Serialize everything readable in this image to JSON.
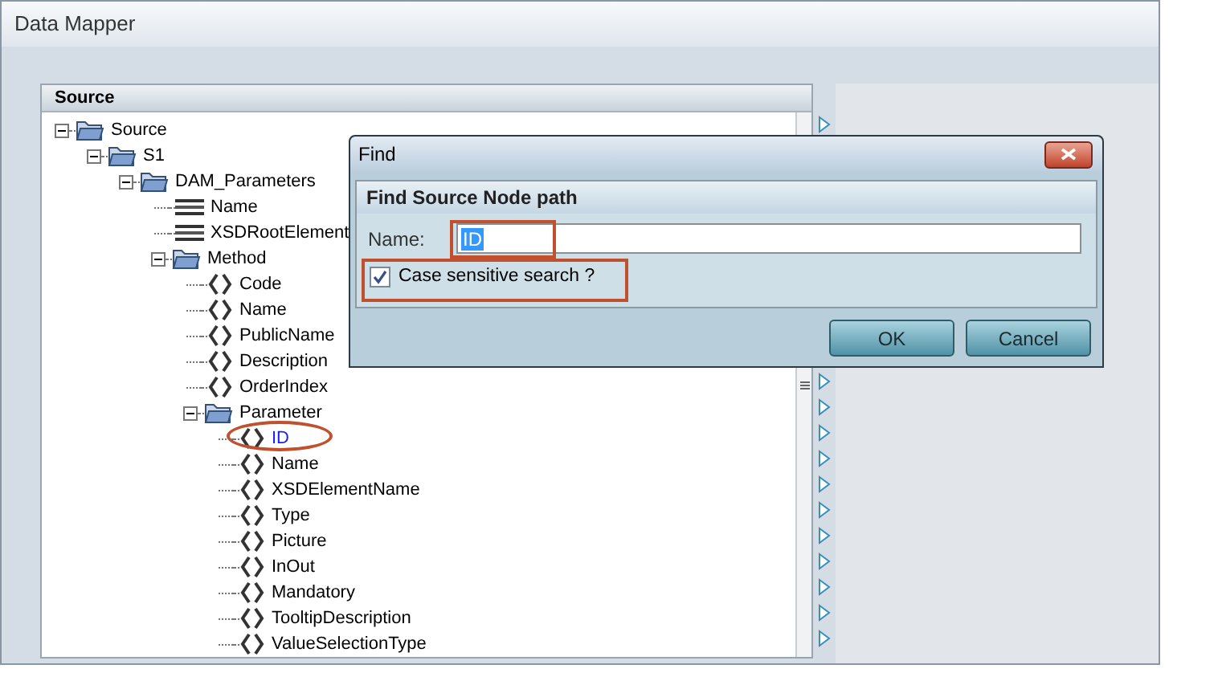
{
  "window": {
    "title": "Data Mapper"
  },
  "source_panel": {
    "title": "Source",
    "tree": [
      {
        "label": "Source",
        "kind": "folder",
        "expanded": true,
        "selected": false,
        "children": [
          {
            "label": "S1",
            "kind": "folder",
            "expanded": true,
            "selected": false,
            "children": [
              {
                "label": "DAM_Parameters",
                "kind": "folder",
                "expanded": true,
                "selected": false,
                "children": [
                  {
                    "label": "Name",
                    "kind": "field",
                    "selected": false
                  },
                  {
                    "label": "XSDRootElement",
                    "kind": "field",
                    "selected": false
                  },
                  {
                    "label": "Method",
                    "kind": "folder",
                    "expanded": true,
                    "selected": false,
                    "children": [
                      {
                        "label": "Code",
                        "kind": "element",
                        "selected": false
                      },
                      {
                        "label": "Name",
                        "kind": "element",
                        "selected": false
                      },
                      {
                        "label": "PublicName",
                        "kind": "element",
                        "selected": false
                      },
                      {
                        "label": "Description",
                        "kind": "element",
                        "selected": false
                      },
                      {
                        "label": "OrderIndex",
                        "kind": "element",
                        "selected": false
                      },
                      {
                        "label": "Parameter",
                        "kind": "folder",
                        "expanded": true,
                        "selected": false,
                        "children": [
                          {
                            "label": "ID",
                            "kind": "element",
                            "selected": true
                          },
                          {
                            "label": "Name",
                            "kind": "element",
                            "selected": false
                          },
                          {
                            "label": "XSDElementName",
                            "kind": "element",
                            "selected": false
                          },
                          {
                            "label": "Type",
                            "kind": "element",
                            "selected": false
                          },
                          {
                            "label": "Picture",
                            "kind": "element",
                            "selected": false
                          },
                          {
                            "label": "InOut",
                            "kind": "element",
                            "selected": false
                          },
                          {
                            "label": "Mandatory",
                            "kind": "element",
                            "selected": false
                          },
                          {
                            "label": "TooltipDescription",
                            "kind": "element",
                            "selected": false
                          },
                          {
                            "label": "ValueSelectionType",
                            "kind": "element",
                            "selected": false
                          }
                        ]
                      }
                    ]
                  }
                ]
              }
            ]
          }
        ]
      }
    ]
  },
  "dialog": {
    "title": "Find",
    "group_title": "Find Source Node path",
    "name_label": "Name:",
    "name_value": "ID",
    "case_sensitive": {
      "label": "Case sensitive search ?",
      "checked": true
    },
    "buttons": [
      "OK",
      "Cancel"
    ]
  }
}
